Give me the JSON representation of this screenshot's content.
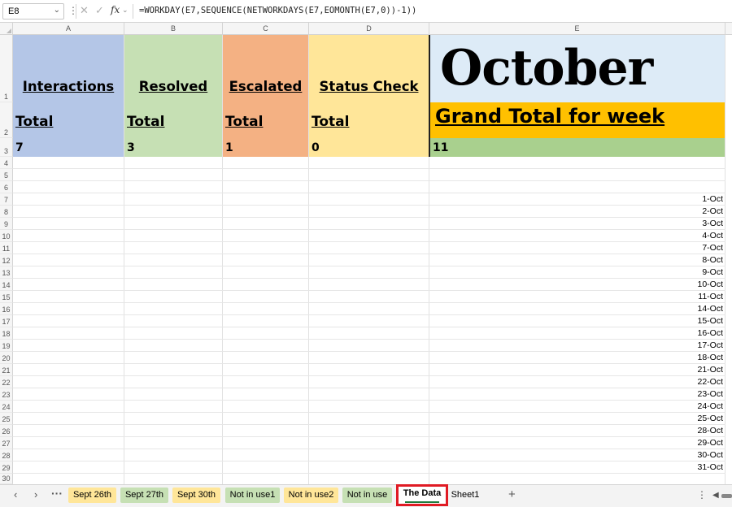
{
  "formula_bar": {
    "name_box": "E8",
    "formula": "=WORKDAY(E7,SEQUENCE(NETWORKDAYS(E7,EOMONTH(E7,0))-1))",
    "fx_label": "fx"
  },
  "columns": [
    "A",
    "B",
    "C",
    "D",
    "E"
  ],
  "rows": [
    "1",
    "2",
    "3",
    "4",
    "5",
    "6",
    "7",
    "8",
    "9",
    "10",
    "11",
    "12",
    "13",
    "14",
    "15",
    "16",
    "17",
    "18",
    "19",
    "20",
    "21",
    "22",
    "23",
    "24",
    "25",
    "26",
    "27",
    "28",
    "29",
    "30"
  ],
  "headers": {
    "a1": "Interactions",
    "b1": "Resolved",
    "c1": "Escalated",
    "d1": "Status Check",
    "e1": "October"
  },
  "totals": {
    "a2": "Total",
    "b2": "Total",
    "c2": "Total",
    "d2": "Total",
    "e2": "Grand Total for week"
  },
  "values": {
    "a3": "7",
    "b3": "3",
    "c3": "1",
    "d3": "0",
    "e3": "11"
  },
  "dates": [
    "1-Oct",
    "2-Oct",
    "3-Oct",
    "4-Oct",
    "7-Oct",
    "8-Oct",
    "9-Oct",
    "10-Oct",
    "11-Oct",
    "14-Oct",
    "15-Oct",
    "16-Oct",
    "17-Oct",
    "18-Oct",
    "21-Oct",
    "22-Oct",
    "23-Oct",
    "24-Oct",
    "25-Oct",
    "28-Oct",
    "29-Oct",
    "30-Oct",
    "31-Oct"
  ],
  "sheet_tabs": {
    "t1": "Sept 26th",
    "t2": "Sept 27th",
    "t3": "Sept 30th",
    "t4": "Not in use1",
    "t5": "Not in use2",
    "t6": "Not in use",
    "active": "The Data",
    "t8": "Sheet1"
  },
  "colors": {
    "interactions_fill": "#b4c6e7",
    "resolved_fill": "#c6e0b4",
    "escalated_fill": "#f4b183",
    "status_fill": "#ffe699",
    "month_fill": "#ddebf7",
    "grand_total_fill": "#ffc000",
    "grand_value_fill": "#a9d08e",
    "active_tab_highlight": "#e01b24"
  },
  "icons": [
    "chevron-down-icon",
    "more-vertical-icon",
    "cancel-icon",
    "check-icon",
    "function-icon",
    "chevron-left-icon",
    "chevron-right-icon",
    "more-horizontal-icon",
    "plus-icon"
  ]
}
